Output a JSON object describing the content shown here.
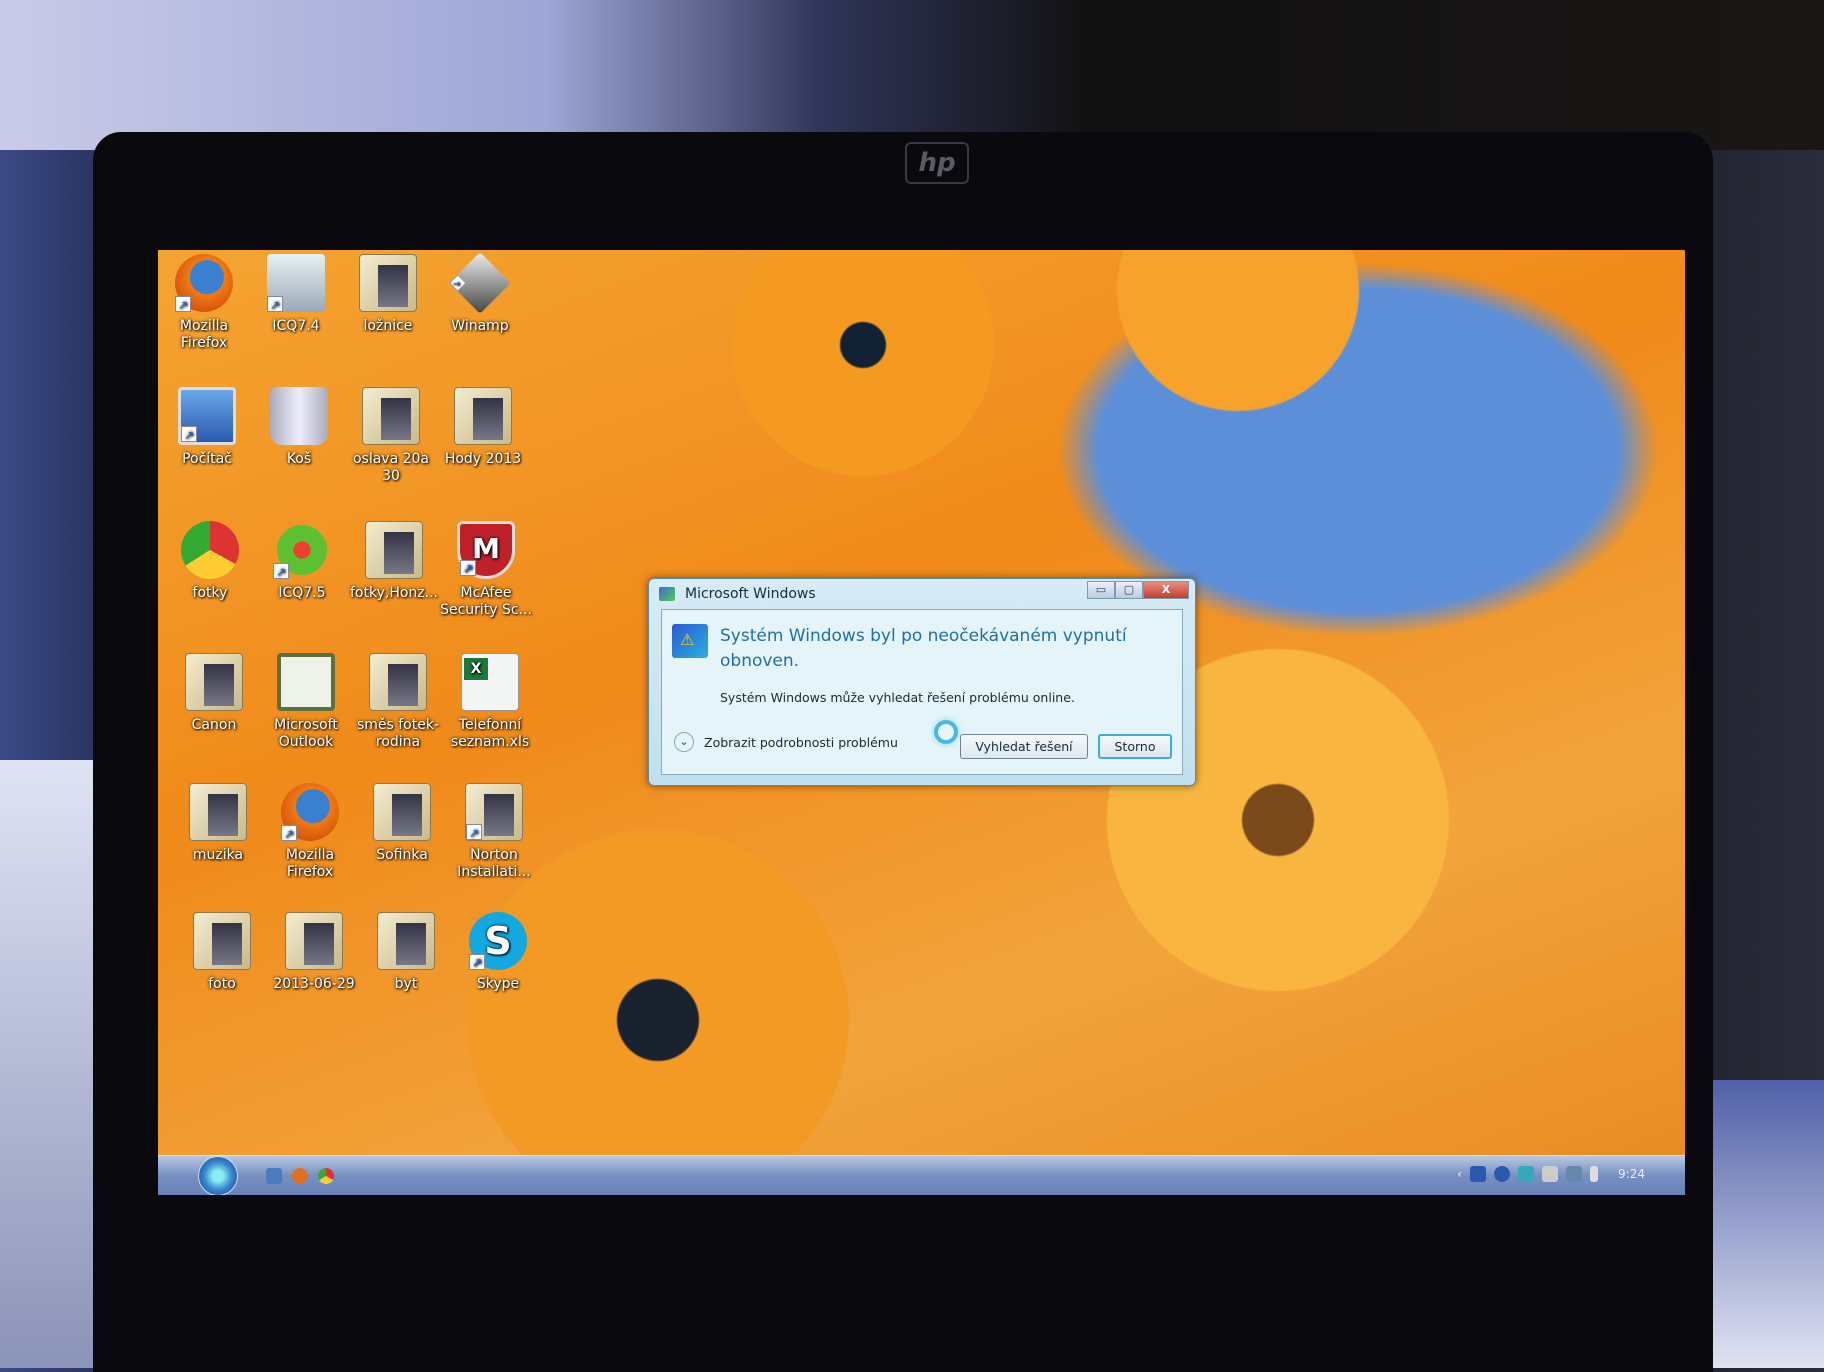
{
  "desktop": {
    "icons": [
      {
        "label": "Mozilla Firefox",
        "type": "firefox",
        "shortcut": true
      },
      {
        "label": "ICQ7.4",
        "type": "app",
        "shortcut": true
      },
      {
        "label": "ložnice",
        "type": "folder",
        "shortcut": false
      },
      {
        "label": "Winamp",
        "type": "winamp",
        "shortcut": true
      },
      {
        "label": "Počítač",
        "type": "pc",
        "shortcut": true
      },
      {
        "label": "Koš",
        "type": "bin",
        "shortcut": false
      },
      {
        "label": "oslava 20a 30",
        "type": "folder",
        "shortcut": false
      },
      {
        "label": "Hody 2013",
        "type": "folder",
        "shortcut": false
      },
      {
        "label": "fotky",
        "type": "chrome",
        "shortcut": false
      },
      {
        "label": "ICQ7.5",
        "type": "icq",
        "shortcut": true
      },
      {
        "label": "fotky,Honz...",
        "type": "folder",
        "shortcut": false
      },
      {
        "label": "McAfee Security Sc...",
        "type": "mcafee",
        "shortcut": true
      },
      {
        "label": "Canon",
        "type": "folder",
        "shortcut": false
      },
      {
        "label": "Microsoft Outlook",
        "type": "outlook",
        "shortcut": false
      },
      {
        "label": "směs fotek-rodina",
        "type": "folder",
        "shortcut": false
      },
      {
        "label": "Telefonní seznam.xls",
        "type": "xls",
        "shortcut": false
      },
      {
        "label": "muzika",
        "type": "folder",
        "shortcut": false
      },
      {
        "label": "Mozilla Firefox",
        "type": "firefox",
        "shortcut": true
      },
      {
        "label": "Sofinka",
        "type": "folder",
        "shortcut": false
      },
      {
        "label": "Norton Installati...",
        "type": "folder",
        "shortcut": true
      },
      {
        "label": "foto",
        "type": "folder",
        "shortcut": false
      },
      {
        "label": "2013-06-29",
        "type": "folder",
        "shortcut": false
      },
      {
        "label": "byt",
        "type": "folder",
        "shortcut": false
      },
      {
        "label": "Skype",
        "type": "skype",
        "shortcut": true
      }
    ]
  },
  "dialog": {
    "title": "Microsoft Windows",
    "heading": "Systém Windows byl po neočekávaném vypnutí obnoven.",
    "message": "Systém Windows může vyhledat řešení problému online.",
    "details_label": "Zobrazit podrobnosti problému",
    "search_button": "Vyhledat řešení",
    "cancel_button": "Storno",
    "minimize": "▭",
    "maximize": "▢",
    "close": "X"
  },
  "taskbar": {
    "clock": "9:24",
    "tray_expand": "‹"
  },
  "bezel": {
    "brand": "hp"
  }
}
